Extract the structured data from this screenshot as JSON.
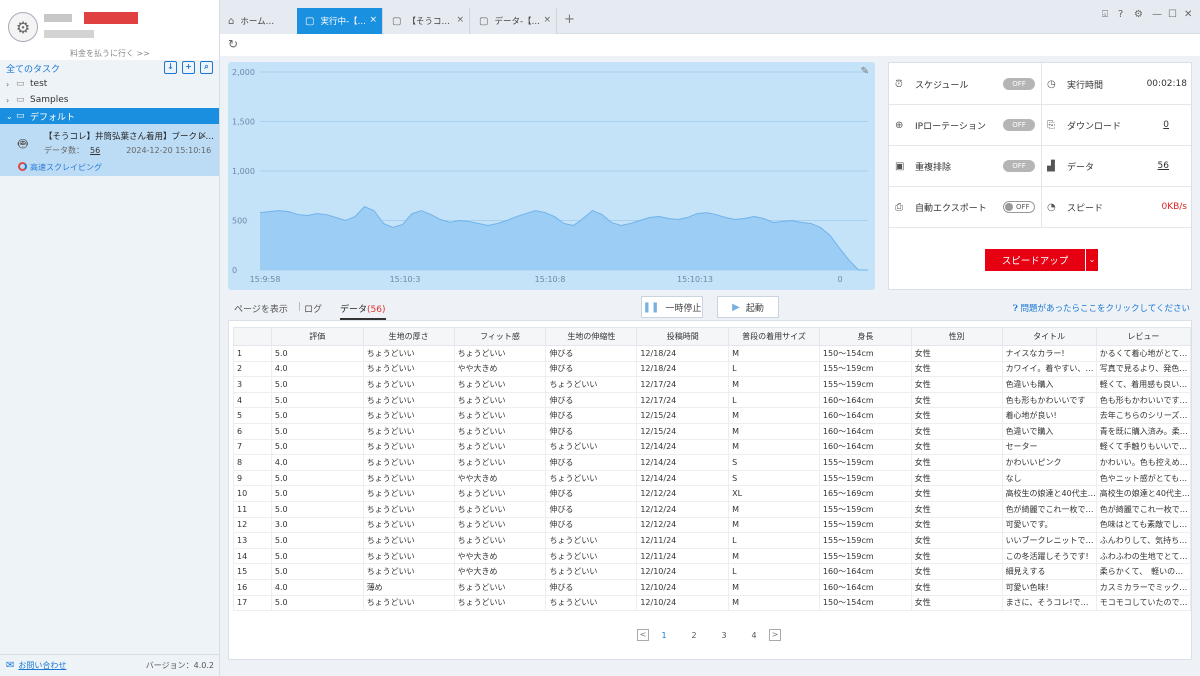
{
  "sidebar": {
    "pay_link": "料金を払うに行く >>",
    "all_tasks": "全てのタスク",
    "tree": [
      {
        "label": "test",
        "selected": false
      },
      {
        "label": "Samples",
        "selected": false
      },
      {
        "label": "デフォルト",
        "selected": true
      }
    ],
    "task": {
      "title": "【そうコレ】井筒弘葉さん着用】ブークレ…",
      "count_label": "データ数：",
      "count": "56",
      "datetime": "2024-12-20 15:10:16",
      "mode": "高速スクレイピング"
    },
    "contact": "お問い合わせ",
    "version": "バージョン：4.0.2"
  },
  "tabs": [
    {
      "label": "ホーム…",
      "icon": "home-icon",
      "active": false
    },
    {
      "label": "実行中-【…",
      "icon": "window-icon",
      "active": true
    },
    {
      "label": "【そうコ…",
      "icon": "window-icon",
      "active": false
    },
    {
      "label": "データ-【…",
      "icon": "window-icon",
      "active": false
    }
  ],
  "chart_data": {
    "type": "area",
    "ylim": [
      0,
      2000
    ],
    "yticks": [
      "2,000",
      "1,500",
      "1,000",
      "500",
      "0"
    ],
    "xticks": [
      "15:9:58",
      "15:10:3",
      "15:10:8",
      "15:10:13",
      "0"
    ],
    "x": [
      0,
      10,
      20,
      30,
      40,
      50,
      60,
      70,
      80,
      90,
      100,
      110,
      120,
      130,
      140,
      150,
      160,
      170,
      180,
      190,
      200,
      210,
      220,
      230,
      240,
      250,
      260,
      270,
      280,
      290,
      300,
      310,
      320,
      330,
      340,
      350,
      360,
      370,
      380,
      390,
      400,
      410,
      420,
      430,
      440,
      450,
      460,
      470,
      480,
      490,
      500,
      510,
      520,
      530,
      540,
      550,
      560,
      570,
      580,
      590,
      600,
      610,
      620,
      630,
      640
    ],
    "values": [
      580,
      590,
      600,
      590,
      560,
      550,
      570,
      560,
      530,
      500,
      540,
      640,
      600,
      470,
      430,
      460,
      570,
      600,
      560,
      510,
      480,
      500,
      490,
      470,
      450,
      470,
      500,
      540,
      570,
      600,
      580,
      540,
      470,
      450,
      520,
      600,
      560,
      480,
      450,
      470,
      500,
      530,
      540,
      520,
      510,
      530,
      570,
      580,
      560,
      530,
      510,
      520,
      540,
      520,
      480,
      490,
      500,
      480,
      470,
      430,
      350,
      220,
      100,
      0,
      0
    ],
    "color": "#9ccdf5",
    "line_color": "#6fb3ec"
  },
  "stats": {
    "schedule": {
      "label": "スケジュール",
      "value": "OFF"
    },
    "run_time": {
      "label": "実行時間",
      "value": "00:02:18"
    },
    "ip_rotation": {
      "label": "IPローテーション",
      "value": "OFF"
    },
    "download": {
      "label": "ダウンロード",
      "value": "0"
    },
    "dedup": {
      "label": "重複排除",
      "value": "OFF"
    },
    "data": {
      "label": "データ",
      "value": "56"
    },
    "auto_export": {
      "label": "自動エクスポート",
      "value": "OFF"
    },
    "speed": {
      "label": "スピード",
      "value": "0KB/s"
    },
    "speedup": "スピードアップ"
  },
  "data_tabs": {
    "page": "ページを表示",
    "log": "ログ",
    "data": "データ",
    "data_count": "(56)",
    "pause": "一時停止",
    "start": "起動",
    "help": "問題があったらここをクリックしてください"
  },
  "table": {
    "headers": [
      "",
      "評価",
      "生地の厚さ",
      "フィット感",
      "生地の伸縮性",
      "投稿時間",
      "普段の着用サイズ",
      "身長",
      "性別",
      "タイトル",
      "レビュー"
    ],
    "rows": [
      [
        "1",
        "5.0",
        "ちょうどいい",
        "ちょうどいい",
        "伸びる",
        "12/18/24",
        "M",
        "150～154cm",
        "女性",
        "ナイスなカラー!",
        "かるくて着心地がとて…"
      ],
      [
        "2",
        "4.0",
        "ちょうどいい",
        "やや大きめ",
        "伸びる",
        "12/18/24",
        "L",
        "155～159cm",
        "女性",
        "カワイイ。着やすい、…",
        "写真で見るより、発色…"
      ],
      [
        "3",
        "5.0",
        "ちょうどいい",
        "ちょうどいい",
        "ちょうどいい",
        "12/17/24",
        "M",
        "155～159cm",
        "女性",
        "色違いも購入",
        "軽くて、着用感も良い…"
      ],
      [
        "4",
        "5.0",
        "ちょうどいい",
        "ちょうどいい",
        "伸びる",
        "12/17/24",
        "L",
        "160～164cm",
        "女性",
        "色も形もかわいいです",
        "色も形もかわいいです…"
      ],
      [
        "5",
        "5.0",
        "ちょうどいい",
        "ちょうどいい",
        "伸びる",
        "12/15/24",
        "M",
        "160～164cm",
        "女性",
        "着心地が良い!",
        "去年こちらのシリーズ…"
      ],
      [
        "6",
        "5.0",
        "ちょうどいい",
        "ちょうどいい",
        "伸びる",
        "12/15/24",
        "M",
        "160～164cm",
        "女性",
        "色違いで購入",
        "青を既に購入済み。柔…"
      ],
      [
        "7",
        "5.0",
        "ちょうどいい",
        "ちょうどいい",
        "ちょうどいい",
        "12/14/24",
        "M",
        "160～164cm",
        "女性",
        "セーター",
        "軽くて手触りもいいで…"
      ],
      [
        "8",
        "4.0",
        "ちょうどいい",
        "ちょうどいい",
        "伸びる",
        "12/14/24",
        "S",
        "155～159cm",
        "女性",
        "かわいいピンク",
        "かわいい。色も控えめ…"
      ],
      [
        "9",
        "5.0",
        "ちょうどいい",
        "やや大きめ",
        "ちょうどいい",
        "12/14/24",
        "S",
        "155～159cm",
        "女性",
        "なし",
        "色やニット感がとても…"
      ],
      [
        "10",
        "5.0",
        "ちょうどいい",
        "ちょうどいい",
        "伸びる",
        "12/12/24",
        "XL",
        "165～169cm",
        "女性",
        "高校生の娘達と40代主…",
        "高校生の娘達と40代主…"
      ],
      [
        "11",
        "5.0",
        "ちょうどいい",
        "ちょうどいい",
        "伸びる",
        "12/12/24",
        "M",
        "155～159cm",
        "女性",
        "色が綺麗でこれ一枚で…",
        "色が綺麗でこれ一枚で…"
      ],
      [
        "12",
        "3.0",
        "ちょうどいい",
        "ちょうどいい",
        "伸びる",
        "12/12/24",
        "M",
        "155～159cm",
        "女性",
        "可愛いです。",
        "色味はとても素敵でし…"
      ],
      [
        "13",
        "5.0",
        "ちょうどいい",
        "ちょうどいい",
        "ちょうどいい",
        "12/11/24",
        "L",
        "155～159cm",
        "女性",
        "いいブークレニットで…",
        "ふんわりして、気持ち…"
      ],
      [
        "14",
        "5.0",
        "ちょうどいい",
        "やや大きめ",
        "ちょうどいい",
        "12/11/24",
        "M",
        "155～159cm",
        "女性",
        "この冬活躍しそうです!",
        "ふわふわの生地でとて…"
      ],
      [
        "15",
        "5.0",
        "ちょうどいい",
        "やや大きめ",
        "ちょうどいい",
        "12/10/24",
        "L",
        "160～164cm",
        "女性",
        "細見えする",
        "柔らかくて、　軽いの…"
      ],
      [
        "16",
        "4.0",
        "薄め",
        "ちょうどいい",
        "伸びる",
        "12/10/24",
        "M",
        "160～164cm",
        "女性",
        "可愛い色味!",
        "カスミカラーでミック…"
      ],
      [
        "17",
        "5.0",
        "ちょうどいい",
        "ちょうどいい",
        "ちょうどいい",
        "12/10/24",
        "M",
        "150～154cm",
        "女性",
        "まさに、そうコレ!で…",
        "モコモコしていたので…"
      ]
    ]
  },
  "pager": {
    "pages": [
      "1",
      "2",
      "3",
      "4"
    ],
    "current": "1",
    "prev": "<",
    "next": ">"
  }
}
